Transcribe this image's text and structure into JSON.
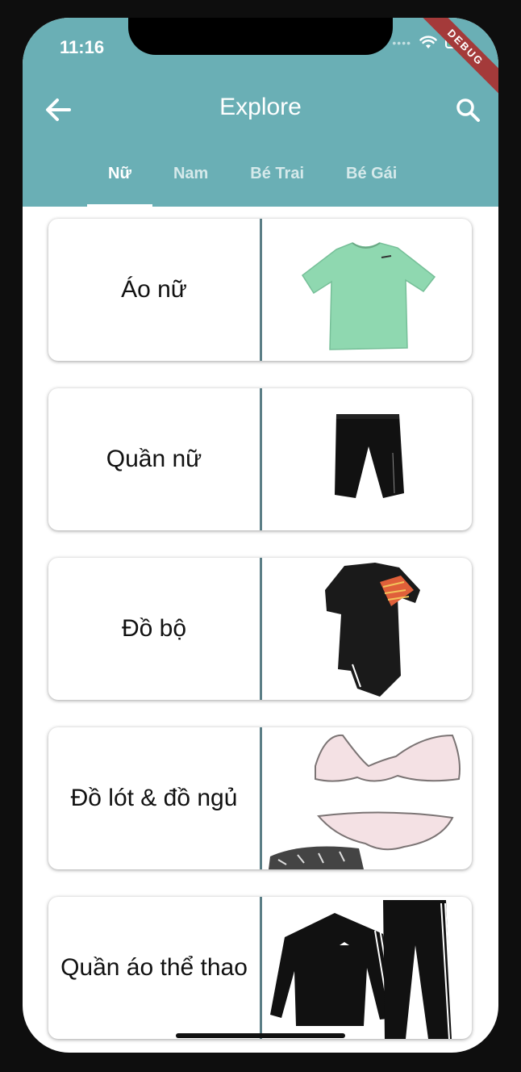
{
  "status": {
    "time": "11:16",
    "debug": "DEBUG"
  },
  "appbar": {
    "title": "Explore",
    "back_icon": "arrow-left-icon",
    "search_icon": "search-icon"
  },
  "tabs": [
    {
      "label": "Nữ",
      "active": true
    },
    {
      "label": "Nam",
      "active": false
    },
    {
      "label": "Bé Trai",
      "active": false
    },
    {
      "label": "Bé Gái",
      "active": false
    }
  ],
  "categories": [
    {
      "label": "Áo nữ",
      "image": "mint-tshirt"
    },
    {
      "label": "Quần nữ",
      "image": "black-capri-pants"
    },
    {
      "label": "Đồ bộ",
      "image": "black-sport-bodysuit"
    },
    {
      "label": "Đồ lót & đồ ngủ",
      "image": "lingerie-set"
    },
    {
      "label": "Quần áo thể thao",
      "image": "black-tracksuit"
    }
  ],
  "colors": {
    "appbar": "#6aafb5",
    "separator": "#5b7e86",
    "debug": "#a43a3a"
  }
}
